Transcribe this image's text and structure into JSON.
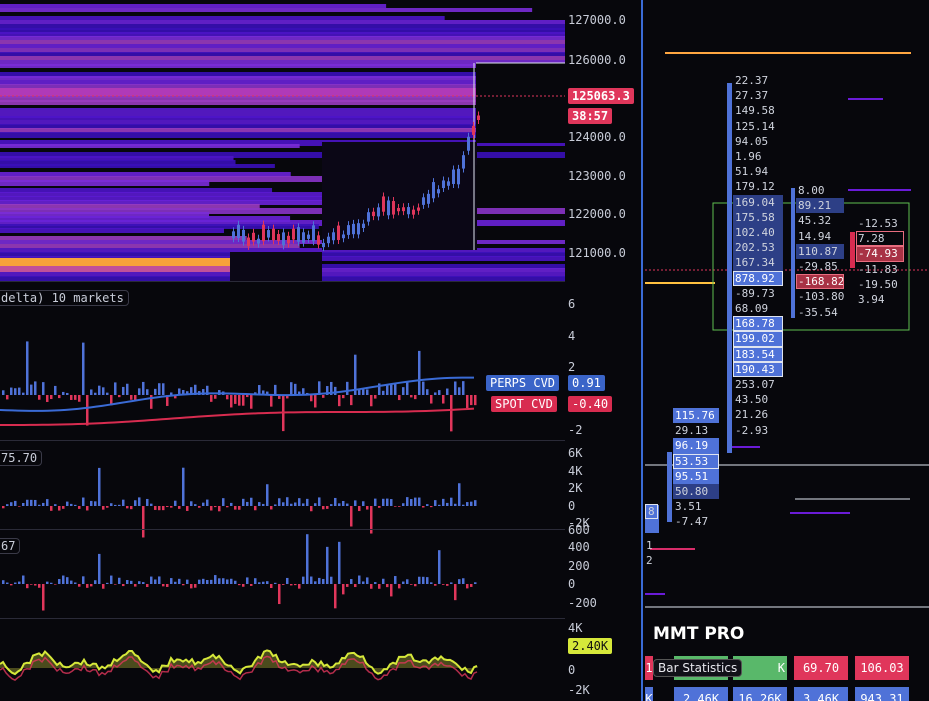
{
  "price_axis": {
    "labels": [
      "127000.0",
      "126000.0",
      "124000.0",
      "123000.0",
      "122000.0",
      "121000.0"
    ],
    "last_price": "125063.3",
    "countdown": "38:57",
    "last_price_color": "#e0365b"
  },
  "cvd_pane": {
    "legend": "delta) 10 markets",
    "axis": [
      "6",
      "4",
      "2",
      "-2"
    ],
    "perps_label": "PERPS CVD",
    "perps_value": "0.91",
    "spot_label": "SPOT CVD",
    "spot_value": "-0.40"
  },
  "pane3": {
    "legend": "75.70",
    "axis": [
      "6K",
      "4K",
      "2K",
      "0",
      "-2K"
    ]
  },
  "pane4": {
    "legend": "67",
    "axis": [
      "600",
      "400",
      "200",
      "0",
      "-200"
    ]
  },
  "pane5": {
    "axis": [
      "4K",
      "0",
      "-2K"
    ],
    "value": "2.40K"
  },
  "footprint": {
    "col1": [
      "22.37",
      "27.37",
      "149.58",
      "125.14",
      "94.05",
      "1.96",
      "51.94",
      "179.12",
      "169.04",
      "175.58",
      "102.40",
      "202.53",
      "167.34",
      "878.92",
      "-89.73",
      "68.09",
      "168.78",
      "199.02",
      "183.54",
      "190.43",
      "253.07",
      "43.50",
      "21.26",
      "-2.93"
    ],
    "col2": [
      "8.00",
      "89.21",
      "45.32",
      "14.94",
      "110.87",
      "-29.85",
      "-168.82",
      "-103.80",
      "-35.54"
    ],
    "col3": [
      "-12.53",
      "7.28",
      "-74.93",
      "-11.83",
      "-19.50",
      "3.94"
    ],
    "col0": [
      "115.76",
      "29.13",
      "96.19",
      "53.53",
      "95.51",
      "50.80",
      "3.51",
      "-7.47"
    ],
    "edge_a": "8",
    "edge_b": [
      "1",
      "2"
    ]
  },
  "brand": "MMT PRO",
  "bar_stats": {
    "title": "Bar Statistics",
    "top_row": [
      "1",
      "",
      "K",
      "69.70",
      "106.03"
    ],
    "bottom_row": [
      "K",
      "2.46K",
      "16.26K",
      "3.46K",
      "943.31"
    ]
  },
  "colors": {
    "bg": "#07070c",
    "blue": "#4f72d8",
    "red": "#e0365b",
    "purple": "#5b1bd0",
    "orange": "#ffa641"
  }
}
